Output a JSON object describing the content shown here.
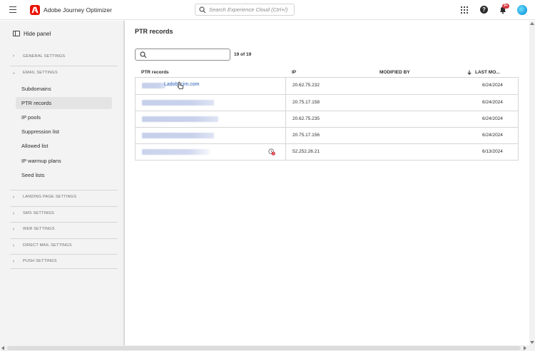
{
  "app": {
    "title": "Adobe Journey Optimizer",
    "search_placeholder": "Search Experience Cloud (Ctrl+/)",
    "notification_badge": "9+",
    "brand_color": "#eb1000"
  },
  "icons": {
    "menu": "hamburger-icon",
    "logo": "adobe-logo-icon",
    "search": "search-icon",
    "apps": "app-grid-icon",
    "help": "help-icon",
    "notifications": "bell-icon",
    "avatar": "user-avatar",
    "panel": "panel-icon",
    "chevron_right": "chevron-right-icon",
    "chevron_down": "chevron-down-icon",
    "sort": "arrow-down-icon",
    "warning": "warning-icon"
  },
  "sidebar": {
    "hide_panel_label": "Hide panel",
    "sections": [
      {
        "label": "GENERAL SETTINGS",
        "expanded": false
      },
      {
        "label": "EMAIL SETTINGS",
        "expanded": true
      },
      {
        "label": "LANDING PAGE SETTINGS",
        "expanded": false
      },
      {
        "label": "SMS SETTINGS",
        "expanded": false
      },
      {
        "label": "WEB SETTINGS",
        "expanded": false
      },
      {
        "label": "DIRECT MAIL SETTINGS",
        "expanded": false
      },
      {
        "label": "PUSH SETTINGS",
        "expanded": false
      }
    ],
    "email_items": [
      {
        "label": "Subdomains",
        "selected": false
      },
      {
        "label": "PTR records",
        "selected": true
      },
      {
        "label": "IP pools",
        "selected": false
      },
      {
        "label": "Suppression list",
        "selected": false
      },
      {
        "label": "Allowed list",
        "selected": false
      },
      {
        "label": "IP warmup plans",
        "selected": false
      },
      {
        "label": "Seed lists",
        "selected": false
      }
    ]
  },
  "main": {
    "title": "PTR records",
    "search_value": "",
    "count": "19 of 19",
    "columns": [
      "PTR records",
      "IP",
      "MODIFIED BY",
      "LAST MO..."
    ],
    "rows": [
      {
        "ptr": "Ladobecim.com",
        "ip": "20.62.75.232",
        "modified_by": "",
        "last_modified": "6/24/2024"
      },
      {
        "ptr": "",
        "ip": "20.75.17.158",
        "modified_by": "",
        "last_modified": "6/24/2024"
      },
      {
        "ptr": "",
        "ip": "20.62.75.235",
        "modified_by": "",
        "last_modified": "6/24/2024"
      },
      {
        "ptr": "",
        "ip": "20.75.17.156",
        "modified_by": "",
        "last_modified": "6/24/2024"
      },
      {
        "ptr": "",
        "ip": "52.252.26.21",
        "modified_by": "",
        "last_modified": "6/13/2024"
      }
    ]
  }
}
